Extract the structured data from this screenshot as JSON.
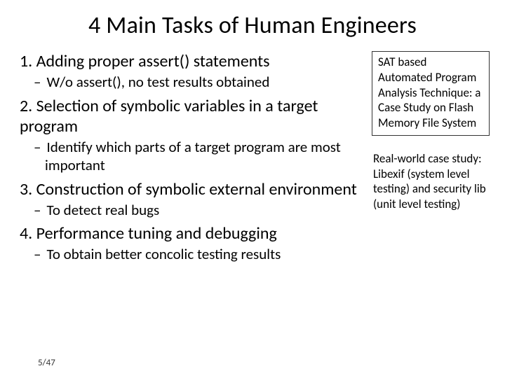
{
  "title": "4 Main Tasks of Human Engineers",
  "tasks": {
    "t1": {
      "heading": "1. Adding proper assert() statements",
      "sub": "W/o assert(), no test results obtained"
    },
    "t2": {
      "heading": "2. Selection of symbolic variables in a target program",
      "sub": "Identify which parts of a target program are most important"
    },
    "t3": {
      "heading": "3. Construction of symbolic external environment",
      "sub": "To detect real bugs"
    },
    "t4": {
      "heading": "4. Performance tuning and debugging",
      "sub": "To obtain better concolic testing results"
    }
  },
  "side": {
    "box": "SAT based Automated Program Analysis Technique: a Case Study on Flash Memory File System",
    "note": "Real-world case study: Libexif (system level testing) and security lib (unit level testing)"
  },
  "page": "5/47"
}
